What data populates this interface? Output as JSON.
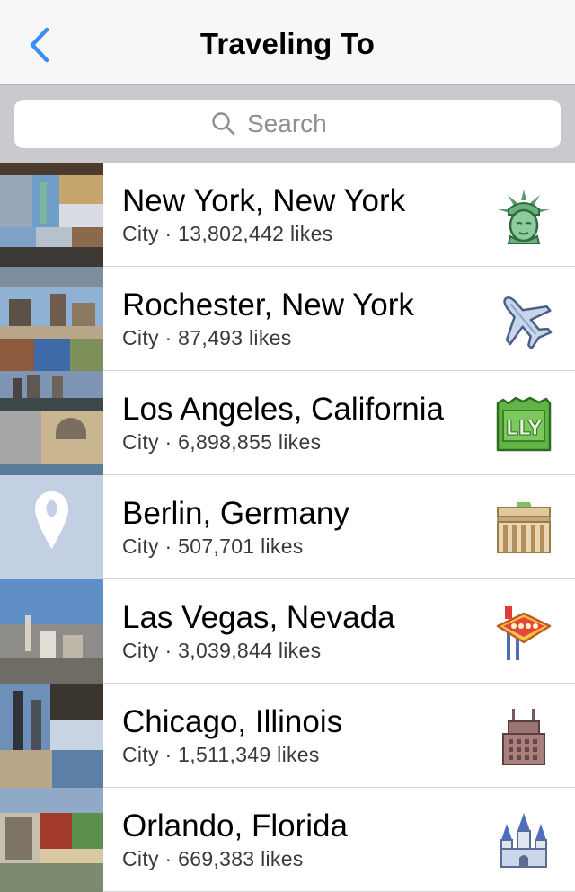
{
  "navbar": {
    "title": "Traveling To"
  },
  "search": {
    "placeholder": "Search"
  },
  "places": [
    {
      "name": "New York, New York",
      "category": "City",
      "likes": "13,802,442 likes",
      "icon": "statue-of-liberty-icon"
    },
    {
      "name": "Rochester, New York",
      "category": "City",
      "likes": "87,493 likes",
      "icon": "airplane-icon"
    },
    {
      "name": "Los Angeles, California",
      "category": "City",
      "likes": "6,898,855 likes",
      "icon": "city-sign-icon"
    },
    {
      "name": "Berlin, Germany",
      "category": "City",
      "likes": "507,701 likes",
      "icon": "brandenburg-gate-icon"
    },
    {
      "name": "Las Vegas, Nevada",
      "category": "City",
      "likes": "3,039,844 likes",
      "icon": "las-vegas-sign-icon"
    },
    {
      "name": "Chicago, Illinois",
      "category": "City",
      "likes": "1,511,349 likes",
      "icon": "skyscraper-icon"
    },
    {
      "name": "Orlando, Florida",
      "category": "City",
      "likes": "669,383 likes",
      "icon": "castle-icon"
    }
  ],
  "colors": {
    "accent": "#3a8ef6",
    "separator": "#d6d6da",
    "search_bar_bg": "#c9c9ce",
    "nav_bg": "#f7f7f7"
  }
}
